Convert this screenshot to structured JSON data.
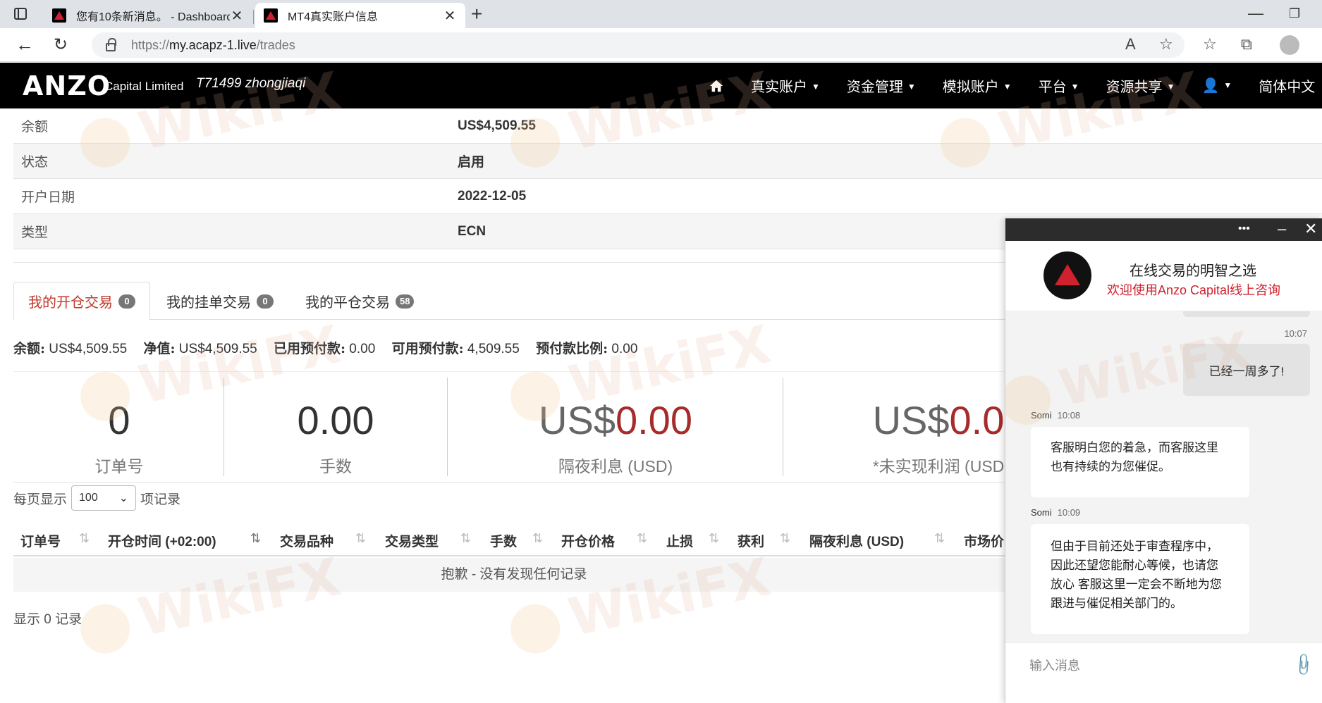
{
  "browser": {
    "tabs": [
      {
        "title": "您有10条新消息。 - Dashboard",
        "close": "✕"
      },
      {
        "title": "MT4真实账户信息",
        "close": "✕"
      }
    ],
    "new_tab": "+",
    "url": {
      "proto": "https://",
      "host": "my.acapz-1.live",
      "path": "/trades"
    }
  },
  "header": {
    "logo": "ANZO",
    "logo_sub": "Capital Limited",
    "account": "T71499 zhongjiaqi",
    "nav": [
      "真实账户",
      "资金管理",
      "模拟账户",
      "平台",
      "资源共享",
      "简体中文"
    ]
  },
  "info": [
    {
      "label": "余额",
      "value": "US$4,509.55"
    },
    {
      "label": "状态",
      "value": "启用"
    },
    {
      "label": "开户日期",
      "value": "2022-12-05"
    },
    {
      "label": "类型",
      "value": "ECN"
    }
  ],
  "tabs": [
    {
      "label": "我的开仓交易",
      "count": "0"
    },
    {
      "label": "我的挂单交易",
      "count": "0"
    },
    {
      "label": "我的平仓交易",
      "count": "58"
    }
  ],
  "summary": [
    {
      "k": "余额:",
      "v": "US$4,509.55"
    },
    {
      "k": "净值:",
      "v": "US$4,509.55"
    },
    {
      "k": "已用预付款:",
      "v": "0.00"
    },
    {
      "k": "可用预付款:",
      "v": "4,509.55"
    },
    {
      "k": "预付款比例:",
      "v": "0.00"
    }
  ],
  "stats": [
    {
      "value": "0",
      "label": "订单号"
    },
    {
      "value": "0.00",
      "label": "手数"
    },
    {
      "prefix": "US$",
      "value": "0.00",
      "label": "隔夜利息 (USD)"
    },
    {
      "prefix": "US$",
      "value": "0.0",
      "label": "*未实现利润 (USD"
    }
  ],
  "table": {
    "per_page_prefix": "每页显示",
    "per_page_value": "100",
    "per_page_suffix": "项记录",
    "columns": [
      "订单号",
      "开仓时间 (+02:00)",
      "交易品种",
      "交易类型",
      "手数",
      "开仓价格",
      "止损",
      "获利",
      "隔夜利息 (USD)",
      "市场价"
    ],
    "empty": "抱歉 - 没有发现任何记录",
    "showing": "显示 0 记录"
  },
  "chat": {
    "menu": "•••",
    "title": "在线交易的明智之选",
    "subtitle": "欢迎使用Anzo Capital线上咨询",
    "messages": [
      {
        "time": "10:07",
        "text": "已经一周多了!"
      },
      {
        "name": "Somi",
        "time": "10:08",
        "text": "客服明白您的着急，而客服这里也有持续的为您催促。"
      },
      {
        "name": "Somi",
        "time": "10:09",
        "text": "但由于目前还处于审查程序中，因此还望您能耐心等候，也请您放心 客服这里一定会不断地为您跟进与催促相关部门的。"
      }
    ],
    "input_placeholder": "输入消息"
  },
  "watermark": "WikiFX"
}
